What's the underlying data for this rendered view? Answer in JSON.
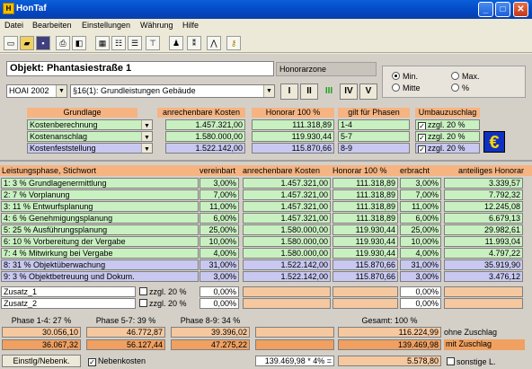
{
  "window": {
    "title": "HonTaf",
    "min_label": "_",
    "max_label": "□",
    "close_label": "✕",
    "app_icon": "ht-icon"
  },
  "menu": [
    "Datei",
    "Bearbeiten",
    "Einstellungen",
    "Währung",
    "Hilfe"
  ],
  "toolbar": [
    "new-icon",
    "open-icon",
    "save-icon",
    "print-icon",
    "preview-icon",
    "calc-icon",
    "table-icon",
    "table2-icon",
    "table3-icon",
    "person-icon",
    "person2-icon",
    "compass-icon",
    "key-icon"
  ],
  "object": {
    "label": "Objekt: Phantasiestraße 1",
    "zone_label": "Honorarzone"
  },
  "hoai": {
    "version": "HOAI 2002",
    "paragraph": "§16(1): Grundleistungen Gebäude"
  },
  "zones": [
    "I",
    "II",
    "III",
    "IV",
    "V"
  ],
  "rate": {
    "min": "Min.",
    "max": "Max.",
    "mitte": "Mitte",
    "pct": "%"
  },
  "grundlage": {
    "headers": [
      "Grundlage",
      "anrechenbare Kosten",
      "Honorar 100 %",
      "gilt für Phasen",
      "Umbauzuschlag"
    ],
    "rows": [
      {
        "name": "Kostenberechnung",
        "kosten": "1.457.321,00",
        "honorar": "111.318,89",
        "phasen": "1-4",
        "zuschlag": "zzgl. 20 %"
      },
      {
        "name": "Kostenanschlag",
        "kosten": "1.580.000,00",
        "honorar": "119.930,44",
        "phasen": "5-7",
        "zuschlag": "zzgl. 20 %"
      },
      {
        "name": "Kostenfeststellung",
        "kosten": "1.522.142,00",
        "honorar": "115.870,66",
        "phasen": "8-9",
        "zuschlag": "zzgl. 20 %"
      }
    ],
    "euro": "€"
  },
  "phases": {
    "headers": [
      "Leistungsphase, Stichwort",
      "vereinbart",
      "anrechenbare Kosten",
      "Honorar 100 %",
      "erbracht",
      "anteiliges Honorar"
    ],
    "rows": [
      {
        "name": "1:   3 % Grundlagenermittlung",
        "vereinbart": "3,00%",
        "kosten": "1.457.321,00",
        "honorar": "111.318,89",
        "erbracht": "3,00%",
        "anteil": "3.339,57"
      },
      {
        "name": "2:   7 % Vorplanung",
        "vereinbart": "7,00%",
        "kosten": "1.457.321,00",
        "honorar": "111.318,89",
        "erbracht": "7,00%",
        "anteil": "7.792,32"
      },
      {
        "name": "3: 11 % Entwurfsplanung",
        "vereinbart": "11,00%",
        "kosten": "1.457.321,00",
        "honorar": "111.318,89",
        "erbracht": "11,00%",
        "anteil": "12.245,08"
      },
      {
        "name": "4:   6 % Genehmigungsplanung",
        "vereinbart": "6,00%",
        "kosten": "1.457.321,00",
        "honorar": "111.318,89",
        "erbracht": "6,00%",
        "anteil": "6.679,13"
      },
      {
        "name": "5: 25 % Ausführungsplanung",
        "vereinbart": "25,00%",
        "kosten": "1.580.000,00",
        "honorar": "119.930,44",
        "erbracht": "25,00%",
        "anteil": "29.982,61"
      },
      {
        "name": "6: 10 % Vorbereitung der Vergabe",
        "vereinbart": "10,00%",
        "kosten": "1.580.000,00",
        "honorar": "119.930,44",
        "erbracht": "10,00%",
        "anteil": "11.993,04"
      },
      {
        "name": "7:   4 % Mitwirkung bei Vergabe",
        "vereinbart": "4,00%",
        "kosten": "1.580.000,00",
        "honorar": "119.930,44",
        "erbracht": "4,00%",
        "anteil": "4.797,22"
      },
      {
        "name": "8: 31 % Objektüberwachung",
        "vereinbart": "31,00%",
        "kosten": "1.522.142,00",
        "honorar": "115.870,66",
        "erbracht": "31,00%",
        "anteil": "35.919,90"
      },
      {
        "name": "9:   3 % Objektbetreuung und Dokum.",
        "vereinbart": "3,00%",
        "kosten": "1.522.142,00",
        "honorar": "115.870,66",
        "erbracht": "3,00%",
        "anteil": "3.476,12"
      }
    ],
    "zusatz": [
      {
        "name": "Zusatz_1",
        "zuschlag": "zzgl. 20 %",
        "vereinbart": "0,00%",
        "erbracht": "0,00%"
      },
      {
        "name": "Zusatz_2",
        "zuschlag": "zzgl. 20 %",
        "vereinbart": "0,00%",
        "erbracht": "0,00%"
      }
    ]
  },
  "totals": {
    "groups": [
      {
        "label": "Phase 1-4: 27 %",
        "ohne": "30.056,10",
        "mit": "36.067,32"
      },
      {
        "label": "Phase 5-7: 39 %",
        "ohne": "46.772,87",
        "mit": "56.127,44"
      },
      {
        "label": "Phase 8-9: 34 %",
        "ohne": "39.396,02",
        "mit": "47.275,22"
      }
    ],
    "gesamt_label": "Gesamt: 100 %",
    "gesamt_ohne": "116.224,99",
    "gesamt_mit": "139.469,98",
    "ohne_label": "ohne Zuschlag",
    "mit_label": "mit Zuschlag"
  },
  "footer": {
    "nebenk_button": "Einstlg/Nebenk.",
    "nebenkosten_label": "Nebenkosten",
    "formula": "139.469,98 * 4% =",
    "nebenkosten_value": "5.578,80",
    "sonstige_label": "sonstige L."
  }
}
